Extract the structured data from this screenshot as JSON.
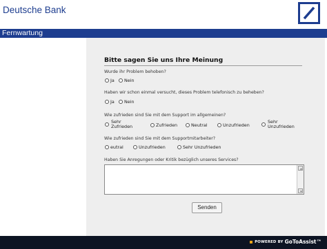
{
  "header": {
    "brand": "Deutsche Bank",
    "logo_icon": "deutsche-bank-slash-logo",
    "brand_color": "#1d3d8f"
  },
  "titlebar": {
    "title": "Fernwartung"
  },
  "survey": {
    "heading": "Bitte sagen Sie uns Ihre Meinung",
    "questions": [
      {
        "text": "Wurde ihr Problem behoben?",
        "options": [
          "Ja",
          "Nein"
        ]
      },
      {
        "text": "Haben wir schon einmal versucht, dieses Problem telefonisch zu beheben?",
        "options": [
          "Ja",
          "Nein"
        ]
      },
      {
        "text": "Wie zufrieden sind Sie mit dem Support im allgemeinen?",
        "options": [
          "Sehr Zufrieden",
          "Zufrieden",
          "Neutral",
          "Unzufrieden",
          "Sehr Unzufrieden"
        ],
        "options_lines": [
          [
            "Sehr",
            "Zufrieden"
          ],
          [
            "Zufrieden"
          ],
          [
            "Neutral"
          ],
          [
            "Unzufrieden"
          ],
          [
            "Sehr",
            "Unzufrieden"
          ]
        ]
      },
      {
        "text": "Wie zufrieden sind Sie mit dem Supportmitarbeiter?",
        "options": [
          "eutral",
          "Unzufrieden",
          "Sehr Unzufrieden"
        ]
      },
      {
        "text": "Haben Sie Anregungen oder Kritik bezüglich unseres Services?",
        "textarea_value": ""
      }
    ],
    "submit_label": "Senden"
  },
  "footer": {
    "powered_prefix": "POWERED BY",
    "powered_brand": "GoToAssist™",
    "accent": "#e8a317"
  }
}
